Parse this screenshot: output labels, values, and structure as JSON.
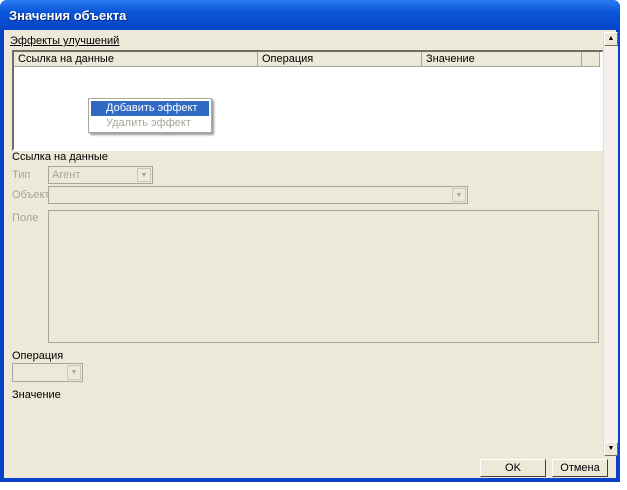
{
  "window": {
    "title": "Значения объекта"
  },
  "effects": {
    "label": "Эффекты улучшений",
    "columns": [
      "Ссылка на данные",
      "Операция",
      "Значение"
    ]
  },
  "context_menu": {
    "items": [
      {
        "label": "Добавить эффект",
        "state": "highlighted"
      },
      {
        "label": "Удалить эффект",
        "state": "disabled"
      }
    ]
  },
  "data_ref": {
    "label": "Ссылка на данные",
    "type_label": "Тип",
    "type_value": "Агент",
    "object_label": "Объект",
    "object_value": "",
    "field_label": "Поле"
  },
  "operation": {
    "label": "Операция",
    "value": ""
  },
  "value": {
    "label": "Значение"
  },
  "buttons": {
    "ok": "OK",
    "cancel": "Отмена"
  },
  "colors": {
    "titlebar": "#0a55d8",
    "client": "#ece9d8",
    "highlight": "#316ac5"
  }
}
